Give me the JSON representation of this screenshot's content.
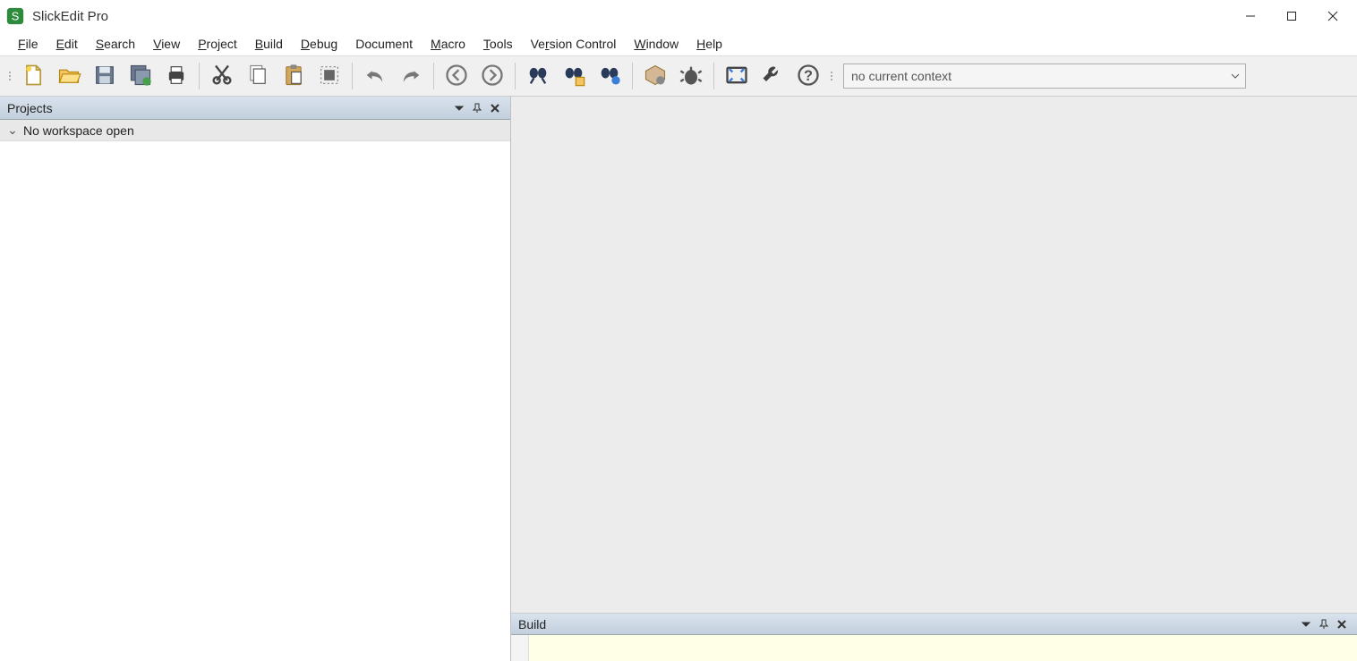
{
  "app": {
    "title": "SlickEdit Pro"
  },
  "menu": {
    "items": [
      {
        "label": "File",
        "u": 0
      },
      {
        "label": "Edit",
        "u": 0
      },
      {
        "label": "Search",
        "u": 0
      },
      {
        "label": "View",
        "u": 0
      },
      {
        "label": "Project",
        "u": 0
      },
      {
        "label": "Build",
        "u": 0
      },
      {
        "label": "Debug",
        "u": 0
      },
      {
        "label": "Document",
        "u": -1
      },
      {
        "label": "Macro",
        "u": 0
      },
      {
        "label": "Tools",
        "u": 0
      },
      {
        "label": "Version Control",
        "u": 2
      },
      {
        "label": "Window",
        "u": 0
      },
      {
        "label": "Help",
        "u": 0
      }
    ]
  },
  "toolbar": {
    "groups": [
      [
        "new-file",
        "open-file",
        "save",
        "save-all",
        "print"
      ],
      [
        "cut",
        "copy",
        "paste",
        "select-all"
      ],
      [
        "undo",
        "redo"
      ],
      [
        "nav-back",
        "nav-forward"
      ],
      [
        "find",
        "find-in-files",
        "replace"
      ],
      [
        "project-settings",
        "debug-start"
      ],
      [
        "fullscreen",
        "tools",
        "help"
      ]
    ],
    "context_text": "no current context"
  },
  "panels": {
    "projects": {
      "title": "Projects",
      "tree_root": "No workspace open"
    },
    "build": {
      "title": "Build"
    }
  }
}
